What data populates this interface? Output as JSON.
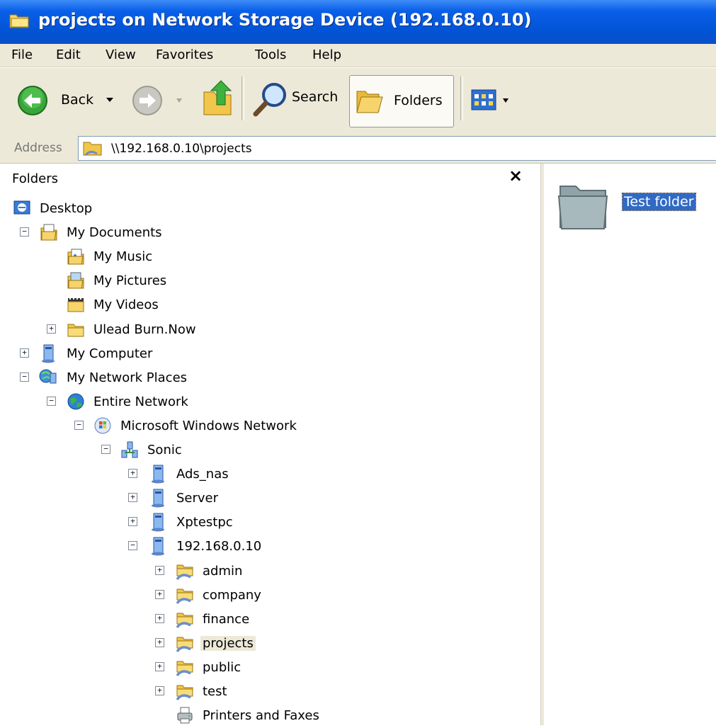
{
  "window": {
    "title": "projects on Network Storage Device (192.168.0.10)"
  },
  "menu": [
    "File",
    "Edit",
    "View",
    "Favorites",
    "Tools",
    "Help"
  ],
  "toolbar": {
    "back_label": "Back",
    "search_label": "Search",
    "folders_label": "Folders"
  },
  "address": {
    "label": "Address",
    "value": "\\\\192.168.0.10\\projects"
  },
  "folders_pane": {
    "title": "Folders",
    "close_symbol": "×"
  },
  "tree": [
    {
      "label": "Desktop",
      "icon": "desktop-icon"
    },
    {
      "label": "My Documents",
      "icon": "my-documents-icon",
      "expander": "−"
    },
    {
      "label": "My Music",
      "icon": "my-music-icon"
    },
    {
      "label": "My Pictures",
      "icon": "my-pictures-icon"
    },
    {
      "label": "My Videos",
      "icon": "my-videos-icon"
    },
    {
      "label": "Ulead Burn.Now",
      "icon": "folder-icon",
      "expander": "+"
    },
    {
      "label": "My Computer",
      "icon": "my-computer-icon",
      "expander": "+"
    },
    {
      "label": "My Network Places",
      "icon": "network-places-icon",
      "expander": "−"
    },
    {
      "label": "Entire Network",
      "icon": "globe-icon",
      "expander": "−"
    },
    {
      "label": "Microsoft Windows Network",
      "icon": "windows-network-icon",
      "expander": "−"
    },
    {
      "label": "Sonic",
      "icon": "workgroup-icon",
      "expander": "−"
    },
    {
      "label": "Ads_nas",
      "icon": "computer-icon",
      "expander": "+"
    },
    {
      "label": "Server",
      "icon": "computer-icon",
      "expander": "+"
    },
    {
      "label": "Xptestpc",
      "icon": "computer-icon",
      "expander": "+"
    },
    {
      "label": "192.168.0.10",
      "icon": "computer-icon",
      "expander": "−"
    },
    {
      "label": "admin",
      "icon": "share-folder-icon",
      "expander": "+"
    },
    {
      "label": "company",
      "icon": "share-folder-icon",
      "expander": "+"
    },
    {
      "label": "finance",
      "icon": "share-folder-icon",
      "expander": "+"
    },
    {
      "label": "projects",
      "icon": "share-folder-icon",
      "expander": "+",
      "selected": true
    },
    {
      "label": "public",
      "icon": "share-folder-icon",
      "expander": "+"
    },
    {
      "label": "test",
      "icon": "share-folder-icon",
      "expander": "+"
    },
    {
      "label": "Printers and Faxes",
      "icon": "printer-icon"
    }
  ],
  "content": {
    "items": [
      {
        "label": "Test folder",
        "icon": "folder-icon",
        "selected": true
      }
    ]
  },
  "colors": {
    "title_bar": "#0054e3",
    "selection": "#316ac5",
    "chrome": "#ece9d8"
  }
}
